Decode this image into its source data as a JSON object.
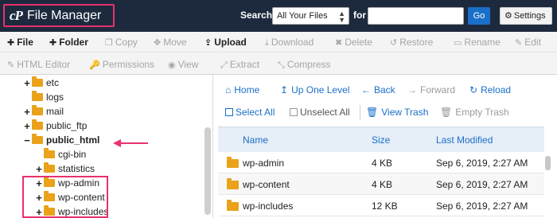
{
  "header": {
    "logo": "cP",
    "title": "File Manager",
    "search_label": "Search",
    "search_scope": "All Your Files",
    "for_label": "for",
    "search_value": "",
    "go_label": "Go",
    "settings_label": "Settings"
  },
  "toolbar": {
    "file": "File",
    "folder": "Folder",
    "copy": "Copy",
    "move": "Move",
    "upload": "Upload",
    "download": "Download",
    "delete": "Delete",
    "restore": "Restore",
    "rename": "Rename",
    "edit": "Edit",
    "html_editor": "HTML Editor",
    "permissions": "Permissions",
    "view": "View",
    "extract": "Extract",
    "compress": "Compress"
  },
  "tree": [
    {
      "label": "etc",
      "expander": "+"
    },
    {
      "label": "logs",
      "expander": ""
    },
    {
      "label": "mail",
      "expander": "+"
    },
    {
      "label": "public_ftp",
      "expander": "+"
    },
    {
      "label": "public_html",
      "expander": "−"
    },
    {
      "label": "cgi-bin",
      "expander": ""
    },
    {
      "label": "statistics",
      "expander": "+"
    },
    {
      "label": "wp-admin",
      "expander": "+"
    },
    {
      "label": "wp-content",
      "expander": "+"
    },
    {
      "label": "wp-includes",
      "expander": "+"
    }
  ],
  "nav": {
    "home": "Home",
    "up_one_level": "Up One Level",
    "back": "Back",
    "forward": "Forward",
    "reload": "Reload",
    "select_all": "Select All",
    "unselect_all": "Unselect All",
    "view_trash": "View Trash",
    "empty_trash": "Empty Trash"
  },
  "table": {
    "columns": [
      "Name",
      "Size",
      "Last Modified"
    ],
    "rows": [
      {
        "name": "wp-admin",
        "size": "4 KB",
        "modified": "Sep 6, 2019, 2:27 AM"
      },
      {
        "name": "wp-content",
        "size": "4 KB",
        "modified": "Sep 6, 2019, 2:27 AM"
      },
      {
        "name": "wp-includes",
        "size": "12 KB",
        "modified": "Sep 6, 2019, 2:27 AM"
      }
    ]
  },
  "colors": {
    "header_bg": "#1d2a3e",
    "accent_blue": "#1a6fc9",
    "highlight_pink": "#e8326b",
    "folder_orange": "#e9a21a"
  },
  "icons": [
    "plus-icon",
    "copy-icon",
    "move-icon",
    "upload-icon",
    "download-icon",
    "delete-icon",
    "restore-icon",
    "rename-icon",
    "edit-icon",
    "html-editor-icon",
    "permissions-icon",
    "view-icon",
    "extract-icon",
    "compress-icon",
    "gear-icon",
    "home-icon",
    "up-arrow-icon",
    "back-arrow-icon",
    "forward-arrow-icon",
    "reload-icon",
    "checkbox-icon",
    "trash-icon",
    "folder-icon"
  ]
}
